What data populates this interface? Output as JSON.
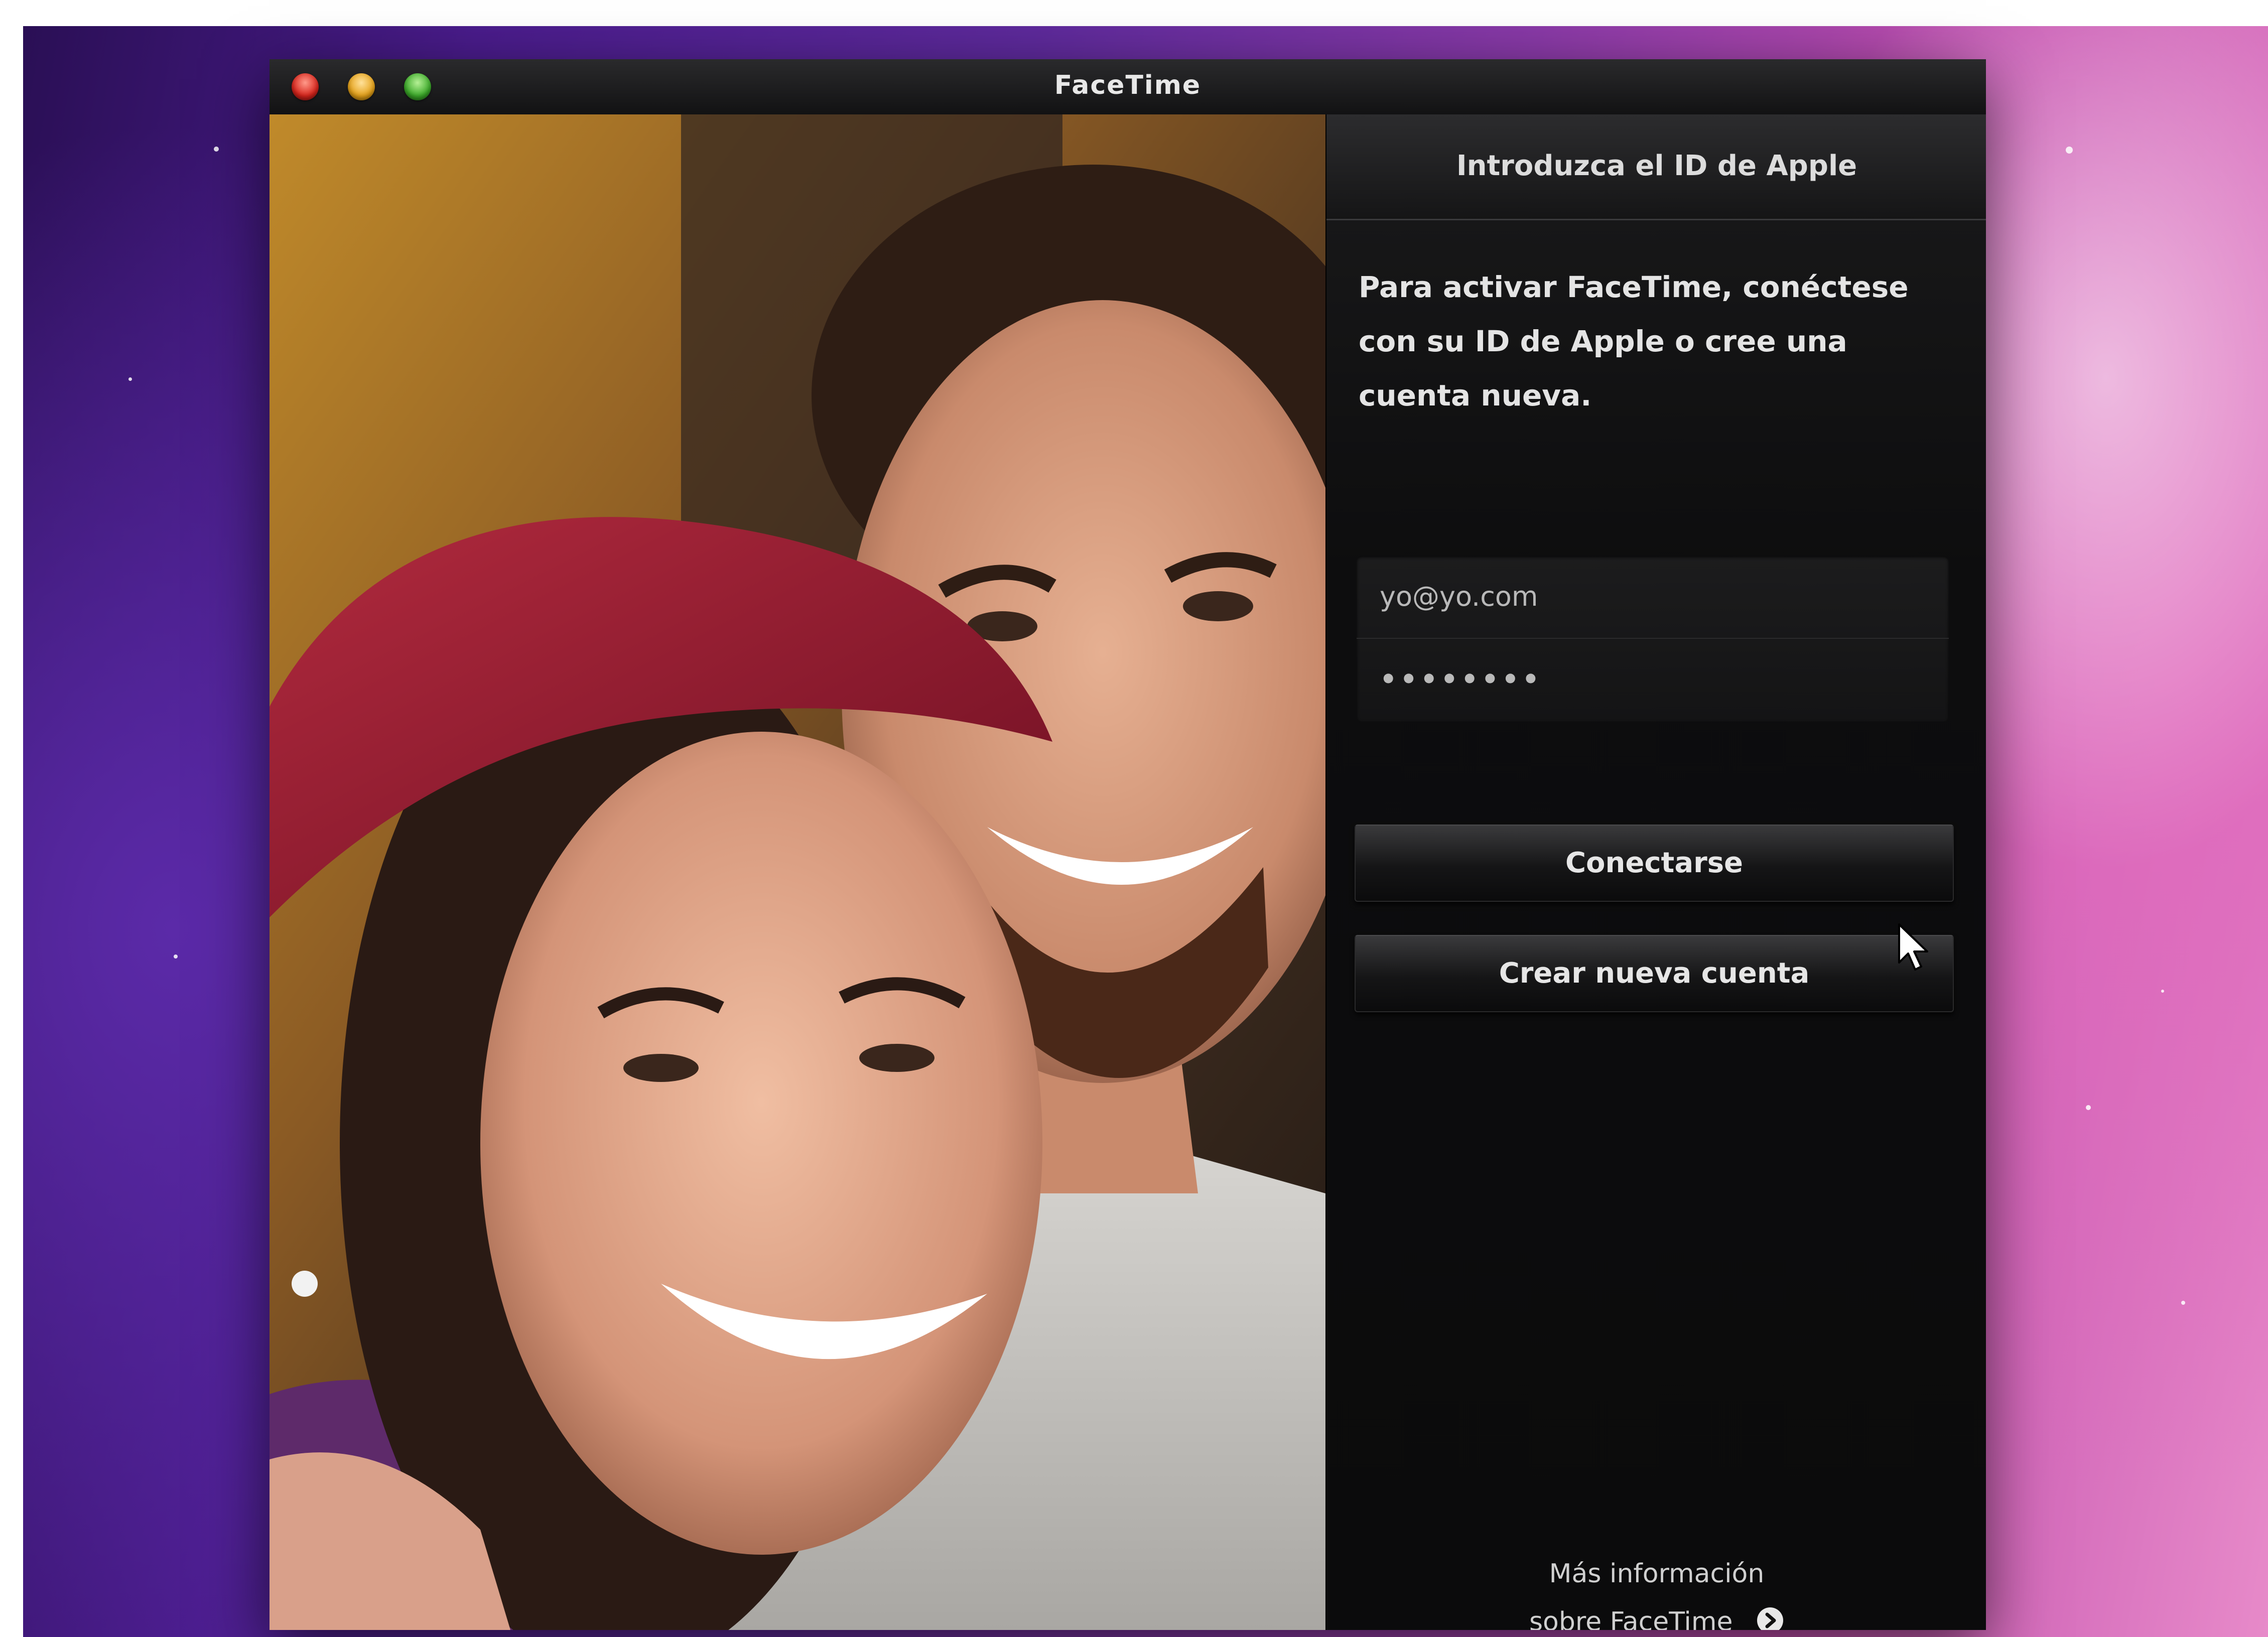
{
  "window": {
    "title": "FaceTime"
  },
  "panel": {
    "header": "Introduzca el ID de Apple",
    "intro": "Para activar FaceTime, conéctese con su ID de Apple o cree una cuenta nueva.",
    "email_value": "yo@yo.com",
    "password_value": "••••••••",
    "connect_label": "Conectarse",
    "create_label": "Crear nueva cuenta",
    "more_info_line1": "Más información",
    "more_info_line2": "sobre FaceTime"
  },
  "icons": {
    "window_controls": [
      "close-icon",
      "minimize-icon",
      "zoom-icon"
    ],
    "more_info": "arrow-circle-icon",
    "pointer": "mouse-pointer-icon"
  },
  "colors": {
    "close": "#d8251c",
    "minimize": "#e5a21a",
    "zoom": "#3caa2a",
    "panel_bg": "#0e0e0f"
  }
}
